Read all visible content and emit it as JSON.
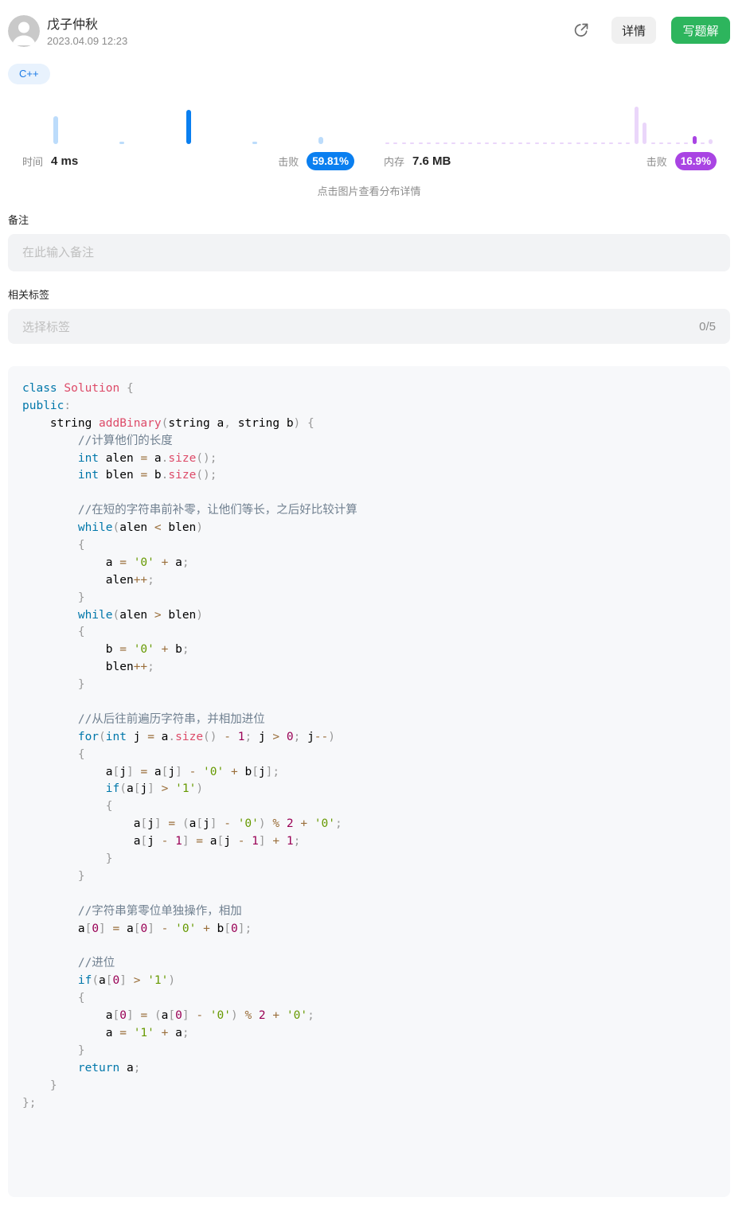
{
  "header": {
    "username": "戊子仲秋",
    "timestamp": "2023.04.09 12:23",
    "detail_button": "详情",
    "write_solution_button": "写题解"
  },
  "icons": {
    "avatar": "avatar-person-icon",
    "share": "share-icon"
  },
  "language_tag": "C++",
  "stats": {
    "time": {
      "label": "时间",
      "value": "4 ms",
      "beats_label": "击败",
      "beats": "59.81%",
      "distribution": {
        "relative_frequency": [
          81,
          7,
          100,
          7,
          21
        ],
        "current_bin": 2
      }
    },
    "memory": {
      "label": "内存",
      "value": "7.6 MB",
      "beats_label": "击败",
      "beats": "16.9%",
      "distribution": {
        "relative_frequency": [
          4,
          4,
          4,
          4,
          4,
          4,
          4,
          4,
          4,
          4,
          4,
          4,
          4,
          4,
          4,
          4,
          4,
          4,
          4,
          4,
          4,
          4,
          4,
          4,
          4,
          4,
          4,
          4,
          4,
          4,
          100,
          57,
          4,
          4,
          4,
          4,
          4,
          21,
          4,
          13
        ],
        "current_bin": 37
      }
    }
  },
  "distribution_hint": "点击图片查看分布详情",
  "note": {
    "label": "备注",
    "placeholder": "在此输入备注"
  },
  "tags": {
    "label": "相关标签",
    "placeholder": "选择标签",
    "count": "0/5"
  },
  "code": {
    "lines": [
      "class Solution {",
      "public:",
      "    string addBinary(string a, string b) {",
      "        //计算他们的长度",
      "        int alen = a.size();",
      "        int blen = b.size();",
      "",
      "        //在短的字符串前补零，让他们等长，之后好比较计算",
      "        while(alen < blen)",
      "        {",
      "            a = '0' + a;",
      "            alen++;",
      "        }",
      "        while(alen > blen)",
      "        {",
      "            b = '0' + b;",
      "            blen++;",
      "        }",
      "",
      "        //从后往前遍历字符串，并相加进位",
      "        for(int j = a.size() - 1; j > 0; j--)",
      "        {",
      "            a[j] = a[j] - '0' + b[j];",
      "            if(a[j] > '1')",
      "            {",
      "                a[j] = (a[j] - '0') % 2 + '0';",
      "                a[j - 1] = a[j - 1] + 1;",
      "            }",
      "        }",
      "",
      "        //字符串第零位单独操作，相加",
      "        a[0] = a[0] - '0' + b[0];",
      "",
      "        //进位",
      "        if(a[0] > '1')",
      "        {",
      "            a[0] = (a[0] - '0') % 2 + '0';",
      "            a = '1' + a;",
      "        }",
      "        return a;",
      "    }",
      "};"
    ]
  },
  "colors": {
    "time_accent": "#0a7ff0",
    "time_bar": "#bcdcfb",
    "memory_accent": "#a944e3",
    "memory_bar": "#ead6fa",
    "write_button": "#2db55d",
    "tag_text": "#1a7ae6"
  }
}
